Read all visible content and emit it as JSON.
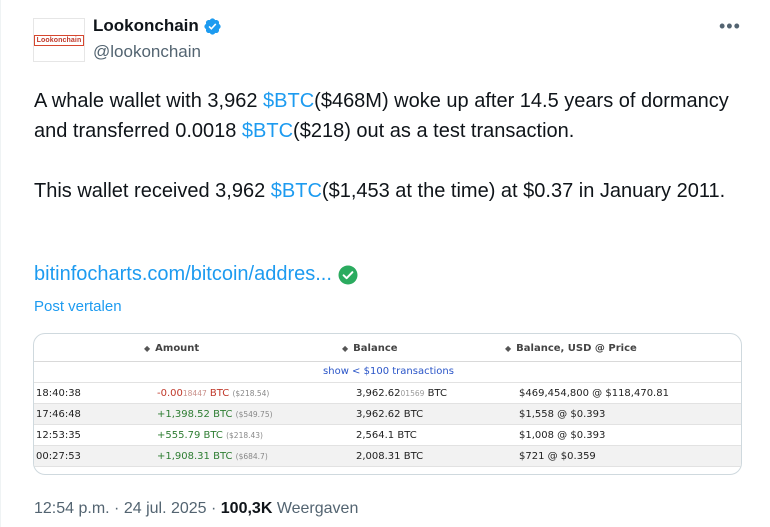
{
  "author": {
    "avatar_text": "Lookonchain",
    "display_name": "Lookonchain",
    "handle": "@lookonchain"
  },
  "more_label": "•••",
  "tweet": {
    "p1_a": "A whale wallet with 3,962 ",
    "p1_tag1": "$BTC",
    "p1_b": "($468M) woke up after 14.5 years of dormancy and transferred 0.0018 ",
    "p1_tag2": "$BTC",
    "p1_c": "($218) out as a test transaction.",
    "p2_a": "This wallet received 3,962 ",
    "p2_tag": "$BTC",
    "p2_b": "($1,453 at the time) at $0.37 in January 2011."
  },
  "link_text": "bitinfocharts.com/bitcoin/addres...",
  "translate_label": "Post vertalen",
  "card": {
    "headers": {
      "amount": "Amount",
      "balance": "Balance",
      "balance_usd": "Balance, USD @ Price"
    },
    "show_link": "show < $100 transactions",
    "rows": [
      {
        "time": "18:40:38",
        "amount_main": "-0.00",
        "amount_small": "18447",
        "amount_unit": " BTC",
        "amount_usd": "($218.54)",
        "balance_main": "3,962.62",
        "balance_small": "01569",
        "balance_unit": " BTC",
        "balance_usd": "$469,454,800 @ $118,470.81"
      },
      {
        "time": "17:46:48",
        "amount_main": "+1,398.52",
        "amount_small": "",
        "amount_unit": " BTC",
        "amount_usd": "($549.75)",
        "balance_main": "3,962.62",
        "balance_small": "",
        "balance_unit": " BTC",
        "balance_usd": "$1,558 @ $0.393"
      },
      {
        "time": "12:53:35",
        "amount_main": "+555.79",
        "amount_small": "",
        "amount_unit": " BTC",
        "amount_usd": "($218.43)",
        "balance_main": "2,564.1",
        "balance_small": "",
        "balance_unit": " BTC",
        "balance_usd": "$1,008 @ $0.393"
      },
      {
        "time": "00:27:53",
        "amount_main": "+1,908.31",
        "amount_small": "",
        "amount_unit": " BTC",
        "amount_usd": "($684.7)",
        "balance_main": "2,008.31",
        "balance_small": "",
        "balance_unit": " BTC",
        "balance_usd": "$721 @ $0.359"
      }
    ]
  },
  "meta": {
    "time": "12:54 p.m.",
    "sep1": " · ",
    "date": "24 jul. 2025",
    "sep2": " · ",
    "views": "100,3K",
    "views_label": " Weergaven"
  },
  "colors": {
    "accent": "#1d9bf0",
    "verified": "#1d9bf0",
    "link_check": "#2bab5f",
    "negative": "#c0392b",
    "positive": "#2e7d32"
  }
}
